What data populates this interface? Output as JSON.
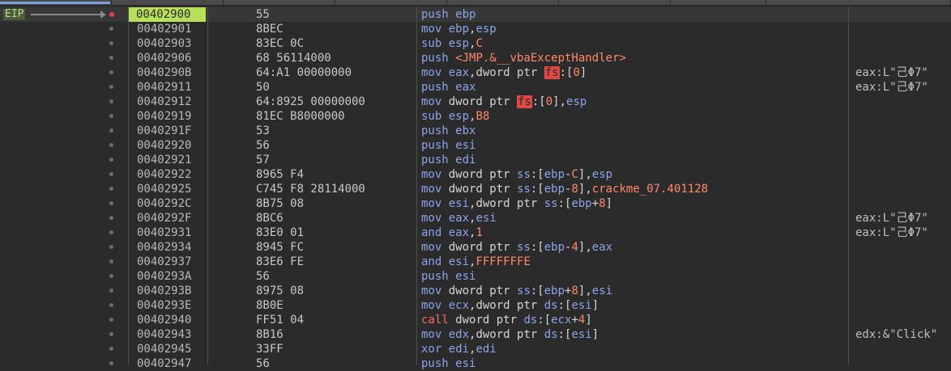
{
  "eip_label": "EIP",
  "rows": [
    {
      "addr": "00402900",
      "bytes": "55",
      "asm": [
        [
          "mn",
          "push "
        ],
        [
          "reg",
          "ebp"
        ]
      ],
      "comment": "",
      "current": true
    },
    {
      "addr": "00402901",
      "bytes": "8BEC",
      "asm": [
        [
          "mn",
          "mov "
        ],
        [
          "reg",
          "ebp"
        ],
        [
          "txt",
          ","
        ],
        [
          "reg",
          "esp"
        ]
      ],
      "comment": ""
    },
    {
      "addr": "00402903",
      "bytes": "83EC 0C",
      "asm": [
        [
          "mn",
          "sub "
        ],
        [
          "reg",
          "esp"
        ],
        [
          "txt",
          ","
        ],
        [
          "num",
          "C"
        ]
      ],
      "comment": ""
    },
    {
      "addr": "00402906",
      "bytes": "68 56114000",
      "asm": [
        [
          "mn",
          "push "
        ],
        [
          "sym",
          "<JMP.&__vbaExceptHandler>"
        ]
      ],
      "comment": ""
    },
    {
      "addr": "0040290B",
      "bytes": "64:A1 00000000",
      "asm": [
        [
          "mn",
          "mov "
        ],
        [
          "reg",
          "eax"
        ],
        [
          "txt",
          ",dword ptr "
        ],
        [
          "seghl",
          "fs"
        ],
        [
          "txt",
          ":["
        ],
        [
          "num",
          "0"
        ],
        [
          "txt",
          "]"
        ]
      ],
      "comment": "eax:L\"⼰Φ7\""
    },
    {
      "addr": "00402911",
      "bytes": "50",
      "asm": [
        [
          "mn",
          "push "
        ],
        [
          "reg",
          "eax"
        ]
      ],
      "comment": "eax:L\"⼰Φ7\""
    },
    {
      "addr": "00402912",
      "bytes": "64:8925 00000000",
      "asm": [
        [
          "mn",
          "mov "
        ],
        [
          "txt",
          "dword ptr "
        ],
        [
          "seghl",
          "fs"
        ],
        [
          "txt",
          ":["
        ],
        [
          "num",
          "0"
        ],
        [
          "txt",
          "],"
        ],
        [
          "reg",
          "esp"
        ]
      ],
      "comment": ""
    },
    {
      "addr": "00402919",
      "bytes": "81EC B8000000",
      "asm": [
        [
          "mn",
          "sub "
        ],
        [
          "reg",
          "esp"
        ],
        [
          "txt",
          ","
        ],
        [
          "num",
          "B8"
        ]
      ],
      "comment": ""
    },
    {
      "addr": "0040291F",
      "bytes": "53",
      "asm": [
        [
          "mn",
          "push "
        ],
        [
          "reg",
          "ebx"
        ]
      ],
      "comment": ""
    },
    {
      "addr": "00402920",
      "bytes": "56",
      "asm": [
        [
          "mn",
          "push "
        ],
        [
          "reg",
          "esi"
        ]
      ],
      "comment": ""
    },
    {
      "addr": "00402921",
      "bytes": "57",
      "asm": [
        [
          "mn",
          "push "
        ],
        [
          "reg",
          "edi"
        ]
      ],
      "comment": ""
    },
    {
      "addr": "00402922",
      "bytes": "8965 F4",
      "asm": [
        [
          "mn",
          "mov "
        ],
        [
          "txt",
          "dword ptr "
        ],
        [
          "seg",
          "ss"
        ],
        [
          "txt",
          ":["
        ],
        [
          "reg",
          "ebp"
        ],
        [
          "txt",
          "-"
        ],
        [
          "num",
          "C"
        ],
        [
          "txt",
          "],"
        ],
        [
          "reg",
          "esp"
        ]
      ],
      "comment": ""
    },
    {
      "addr": "00402925",
      "bytes": "C745 F8 28114000",
      "asm": [
        [
          "mn",
          "mov "
        ],
        [
          "txt",
          "dword ptr "
        ],
        [
          "seg",
          "ss"
        ],
        [
          "txt",
          ":["
        ],
        [
          "reg",
          "ebp"
        ],
        [
          "txt",
          "-"
        ],
        [
          "num",
          "8"
        ],
        [
          "txt",
          "],"
        ],
        [
          "sym",
          "crackme_07.401128"
        ]
      ],
      "comment": ""
    },
    {
      "addr": "0040292C",
      "bytes": "8B75 08",
      "asm": [
        [
          "mn",
          "mov "
        ],
        [
          "reg",
          "esi"
        ],
        [
          "txt",
          ",dword ptr "
        ],
        [
          "seg",
          "ss"
        ],
        [
          "txt",
          ":["
        ],
        [
          "reg",
          "ebp"
        ],
        [
          "txt",
          "+"
        ],
        [
          "num",
          "8"
        ],
        [
          "txt",
          "]"
        ]
      ],
      "comment": ""
    },
    {
      "addr": "0040292F",
      "bytes": "8BC6",
      "asm": [
        [
          "mn",
          "mov "
        ],
        [
          "reg",
          "eax"
        ],
        [
          "txt",
          ","
        ],
        [
          "reg",
          "esi"
        ]
      ],
      "comment": "eax:L\"⼰Φ7\""
    },
    {
      "addr": "00402931",
      "bytes": "83E0 01",
      "asm": [
        [
          "mn",
          "and "
        ],
        [
          "reg",
          "eax"
        ],
        [
          "txt",
          ","
        ],
        [
          "num",
          "1"
        ]
      ],
      "comment": "eax:L\"⼰Φ7\""
    },
    {
      "addr": "00402934",
      "bytes": "8945 FC",
      "asm": [
        [
          "mn",
          "mov "
        ],
        [
          "txt",
          "dword ptr "
        ],
        [
          "seg",
          "ss"
        ],
        [
          "txt",
          ":["
        ],
        [
          "reg",
          "ebp"
        ],
        [
          "txt",
          "-"
        ],
        [
          "num",
          "4"
        ],
        [
          "txt",
          "],"
        ],
        [
          "reg",
          "eax"
        ]
      ],
      "comment": ""
    },
    {
      "addr": "00402937",
      "bytes": "83E6 FE",
      "asm": [
        [
          "mn",
          "and "
        ],
        [
          "reg",
          "esi"
        ],
        [
          "txt",
          ","
        ],
        [
          "num",
          "FFFFFFFE"
        ]
      ],
      "comment": ""
    },
    {
      "addr": "0040293A",
      "bytes": "56",
      "asm": [
        [
          "mn",
          "push "
        ],
        [
          "reg",
          "esi"
        ]
      ],
      "comment": ""
    },
    {
      "addr": "0040293B",
      "bytes": "8975 08",
      "asm": [
        [
          "mn",
          "mov "
        ],
        [
          "txt",
          "dword ptr "
        ],
        [
          "seg",
          "ss"
        ],
        [
          "txt",
          ":["
        ],
        [
          "reg",
          "ebp"
        ],
        [
          "txt",
          "+"
        ],
        [
          "num",
          "8"
        ],
        [
          "txt",
          "],"
        ],
        [
          "reg",
          "esi"
        ]
      ],
      "comment": ""
    },
    {
      "addr": "0040293E",
      "bytes": "8B0E",
      "asm": [
        [
          "mn",
          "mov "
        ],
        [
          "reg",
          "ecx"
        ],
        [
          "txt",
          ",dword ptr "
        ],
        [
          "seg",
          "ds"
        ],
        [
          "txt",
          ":["
        ],
        [
          "reg",
          "esi"
        ],
        [
          "txt",
          "]"
        ]
      ],
      "comment": ""
    },
    {
      "addr": "00402940",
      "bytes": "FF51 04",
      "asm": [
        [
          "call",
          "call "
        ],
        [
          "txt",
          "dword ptr "
        ],
        [
          "seg",
          "ds"
        ],
        [
          "txt",
          ":["
        ],
        [
          "reg",
          "ecx"
        ],
        [
          "txt",
          "+"
        ],
        [
          "num",
          "4"
        ],
        [
          "txt",
          "]"
        ]
      ],
      "comment": ""
    },
    {
      "addr": "00402943",
      "bytes": "8B16",
      "asm": [
        [
          "mn",
          "mov "
        ],
        [
          "reg",
          "edx"
        ],
        [
          "txt",
          ",dword ptr "
        ],
        [
          "seg",
          "ds"
        ],
        [
          "txt",
          ":["
        ],
        [
          "reg",
          "esi"
        ],
        [
          "txt",
          "]"
        ]
      ],
      "comment": "edx:&\"Click\""
    },
    {
      "addr": "00402945",
      "bytes": "33FF",
      "asm": [
        [
          "mn",
          "xor "
        ],
        [
          "reg",
          "edi"
        ],
        [
          "txt",
          ","
        ],
        [
          "reg",
          "edi"
        ]
      ],
      "comment": ""
    },
    {
      "addr": "00402947",
      "bytes": "56",
      "asm": [
        [
          "mn",
          "push "
        ],
        [
          "reg",
          "esi"
        ]
      ],
      "comment": ""
    }
  ]
}
